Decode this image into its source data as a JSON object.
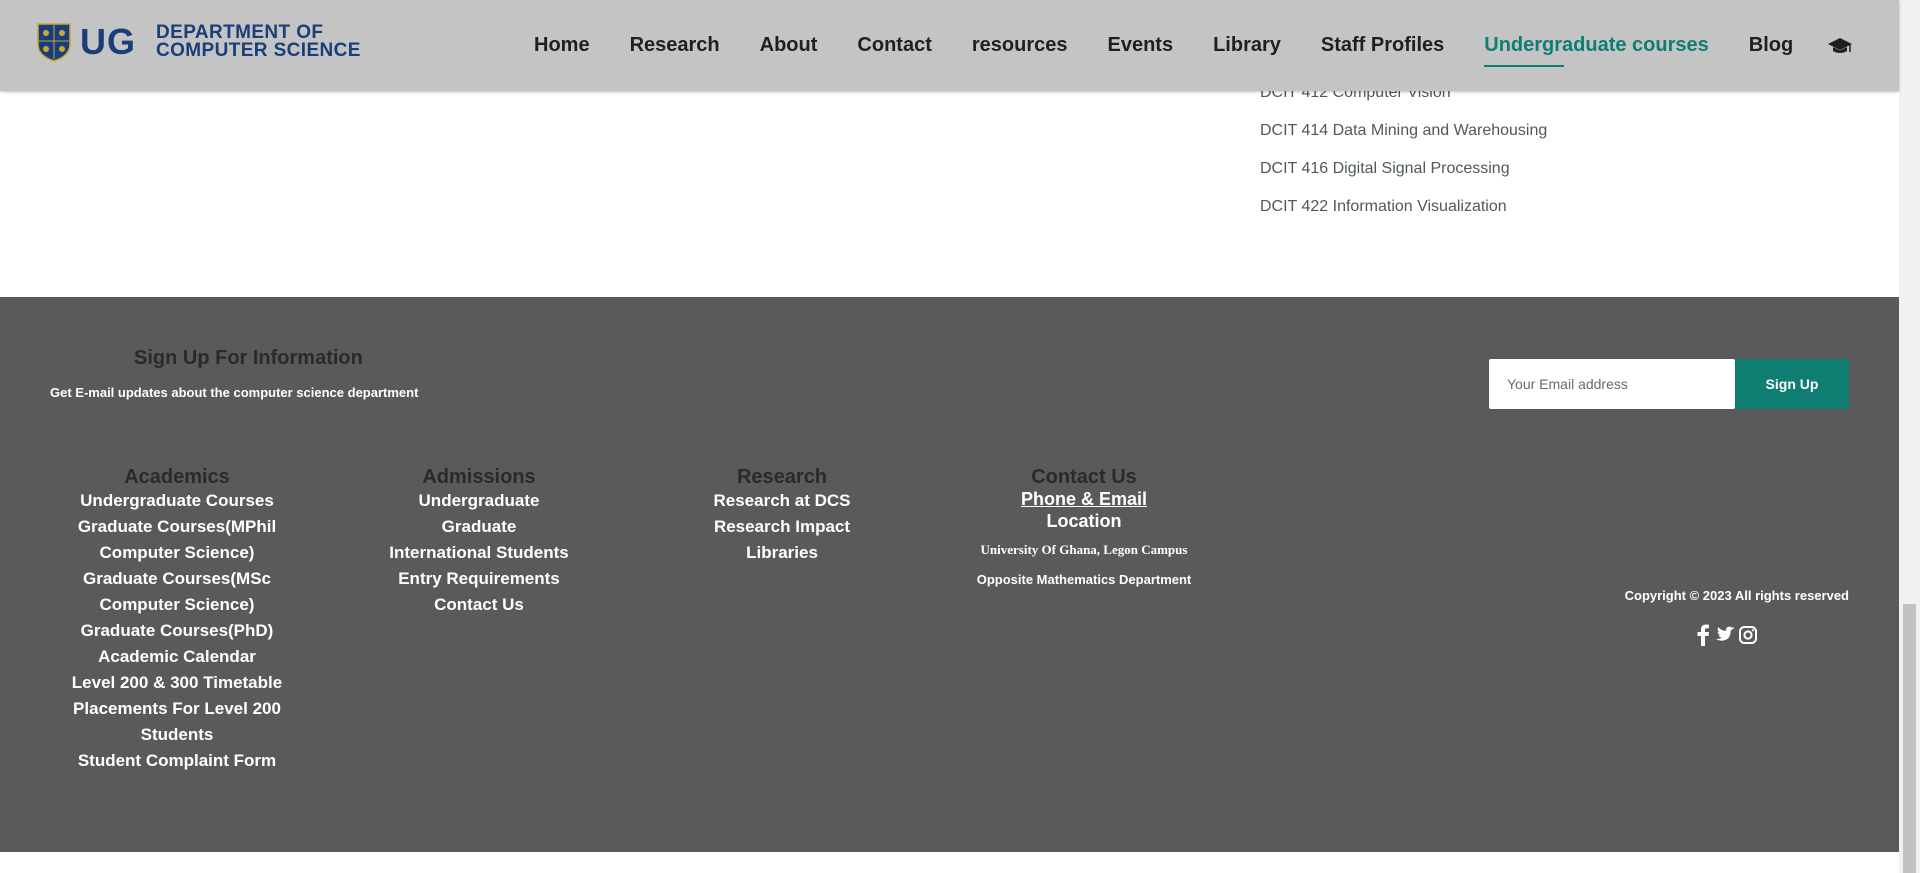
{
  "header": {
    "logo_ug": "UG",
    "logo_line1": "DEPARTMENT OF",
    "logo_line2": "COMPUTER SCIENCE",
    "nav": [
      "Home",
      "Research",
      "About",
      "Contact",
      "resources",
      "Events",
      "Library",
      "Staff Profiles",
      "Undergraduate courses",
      "Blog"
    ],
    "active_nav": "Undergraduate courses",
    "extra_icon": "graduation-cap-icon"
  },
  "courses": [
    "DCIT 412 Computer Vision",
    "DCIT 414 Data Mining and Warehousing",
    "DCIT 416 Digital Signal Processing",
    "DCIT 422 Information Visualization"
  ],
  "signup": {
    "title": "Sign Up For Information",
    "subtitle": "Get E-mail updates about the computer science department",
    "placeholder": "Your Email address",
    "button": "Sign Up"
  },
  "footer": {
    "academics": {
      "title": "Academics",
      "links": [
        "Undergraduate Courses",
        "Graduate Courses(MPhil Computer Science)",
        "Graduate Courses(MSc Computer Science)",
        "Graduate Courses(PhD)",
        "Academic Calendar",
        "Level 200 & 300 Timetable",
        "Placements For Level 200 Students",
        "Student Complaint Form"
      ]
    },
    "admissions": {
      "title": "Admissions",
      "links": [
        "Undergraduate",
        "Graduate",
        "International Students",
        "Entry Requirements",
        "Contact Us"
      ]
    },
    "research": {
      "title": "Research",
      "links": [
        "Research at DCS",
        "Research Impact",
        "Libraries"
      ]
    },
    "contact": {
      "title": "Contact Us",
      "phone_email": "Phone & Email",
      "location": "Location",
      "campus": "University Of Ghana, Legon Campus",
      "opposite": "Opposite Mathematics Department"
    },
    "copyright": "Copyright © 2023 All rights reserved",
    "social": [
      "facebook-icon",
      "twitter-icon",
      "instagram-icon"
    ]
  },
  "colors": {
    "brand_blue": "#1a3e7a",
    "accent_teal": "#0e7e73",
    "footer_bg": "#5a5a5a",
    "header_bg": "#c4c4c4"
  }
}
